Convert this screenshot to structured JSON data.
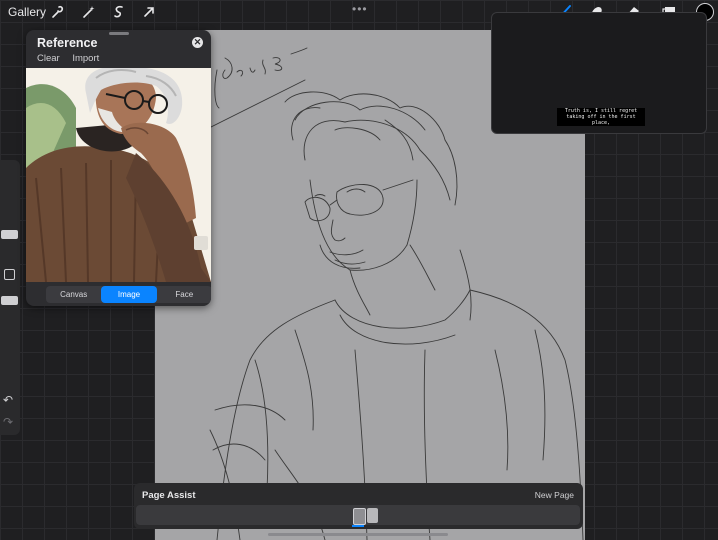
{
  "topbar": {
    "gallery_label": "Gallery",
    "center_dots": "•••",
    "left_icons": [
      "wrench-icon",
      "magic-wand-icon",
      "selection-icon",
      "transform-arrow-icon"
    ],
    "right_icons": [
      "brush-icon",
      "smudge-icon",
      "eraser-icon",
      "layers-icon",
      "color-swatch"
    ],
    "active_color": "#000000",
    "accent_color": "#0a84ff"
  },
  "reference": {
    "title": "Reference",
    "clear_label": "Clear",
    "import_label": "Import",
    "close_icon": "close-icon",
    "tabs": [
      {
        "label": "Canvas",
        "active": false
      },
      {
        "label": "Image",
        "active": true
      },
      {
        "label": "Face",
        "active": false
      }
    ]
  },
  "canvas": {
    "signature": "Doris Sr."
  },
  "preview": {
    "speech_line1": "Truth is, I still regret",
    "speech_line2": "taking off in the first place,"
  },
  "page_assist": {
    "title": "Page Assist",
    "new_page_label": "New Page"
  }
}
